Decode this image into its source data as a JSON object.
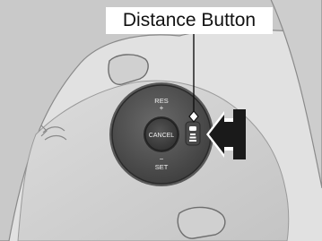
{
  "callout": {
    "label": "Distance Button"
  },
  "controls": {
    "resume_label": "RES",
    "resume_sign": "+",
    "cancel_label": "CANCEL",
    "set_sign": "−",
    "set_label": "SET"
  },
  "icons": {
    "distance": "car-distance-icon",
    "pointer": "pointing-arrow-icon",
    "scroll": "scroll-wheel-icon"
  }
}
